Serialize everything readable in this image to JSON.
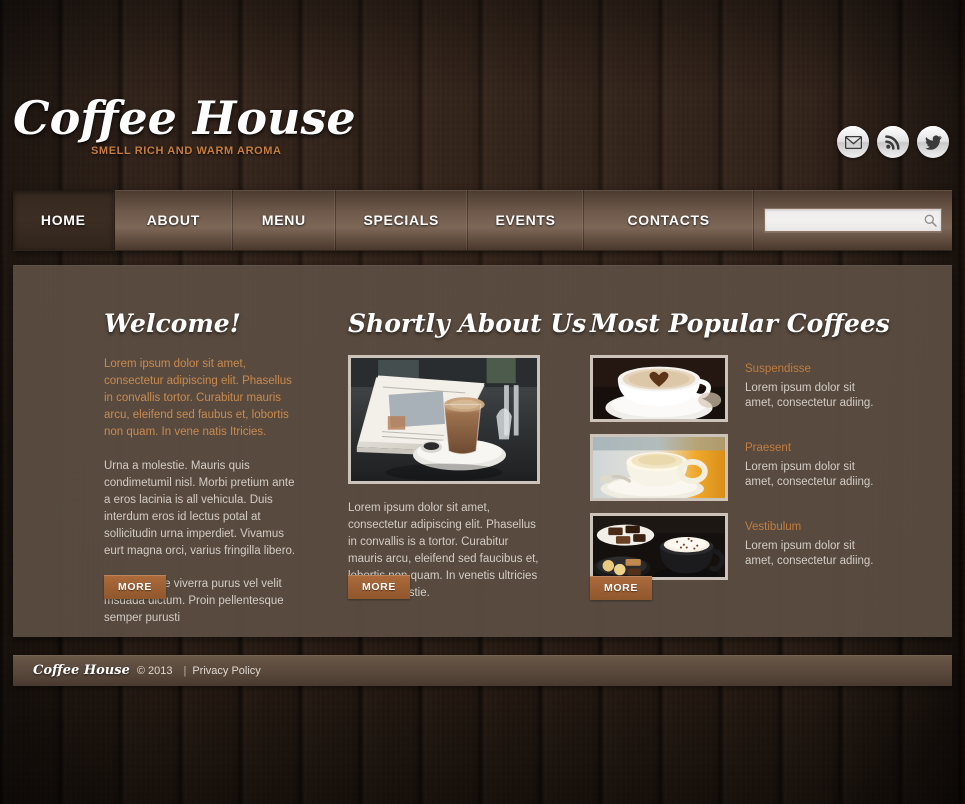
{
  "site": {
    "logo_title": "Coffee House",
    "logo_tagline": "SMELL RICH AND WARM AROMA"
  },
  "theme": {
    "accent_orange": "#c67d3e",
    "button_brown": "#9c5f33",
    "panel_brown": "#5c4e42",
    "wood_dark": "#2a1d16",
    "body_text": "#d3cdc6"
  },
  "social": [
    {
      "name": "mail-icon",
      "label": "Email"
    },
    {
      "name": "rss-icon",
      "label": "RSS"
    },
    {
      "name": "twitter-icon",
      "label": "Twitter"
    }
  ],
  "nav": {
    "items": [
      {
        "label": "HOME",
        "active": true
      },
      {
        "label": "ABOUT",
        "active": false
      },
      {
        "label": "MENU",
        "active": false
      },
      {
        "label": "SPECIALS",
        "active": false
      },
      {
        "label": "EVENTS",
        "active": false
      },
      {
        "label": "CONTACTS",
        "active": false
      }
    ]
  },
  "search": {
    "value": "",
    "placeholder": "",
    "icon": "search-icon"
  },
  "columns": {
    "welcome": {
      "heading": "Welcome!",
      "intro": "Lorem ipsum dolor sit amet, consectetur adipiscing elit. Phasellus in convallis tortor. Curabitur mauris arcu, eleifend sed faubus et, lobortis non quam. In vene natis  Itricies.",
      "paragraph_1": "Urna a molestie. Mauris quis condimetumil nisl. Morbi pretium ante a eros lacinia is all vehicula. Duis interdum eros id lectus potal at sollicitudin urna imperdiet. Vivamus eurt magna orci, varius fringilla libero.",
      "paragraph_2": "Pellentesque viverra purus vel velit msuada dictum. Proin pellentesque semper purusti",
      "more_label": "MORE"
    },
    "about": {
      "heading": "Shortly About Us",
      "photo_alt": "latte glass beside newspapers on a cafe table",
      "paragraph": "Lorem ipsum dolor sit amet, consectetur adipiscing elit. Phasellus in convallis is a tortor. Curabitur mauris arcu, eleifend sed faucibus et, lobortis non quam. In venetis ultricies urna a molestie.",
      "more_label": "MORE"
    },
    "coffees": {
      "heading": "Most Popular Coffees",
      "more_label": "MORE",
      "items": [
        {
          "title": "Suspendisse",
          "desc": "Lorem ipsum dolor sit amet, consectetur adiing.",
          "photo_alt": "cappuccino with cocoa heart on foam"
        },
        {
          "title": "Praesent",
          "desc": "Lorem ipsum dolor sit amet, consectetur adiing.",
          "photo_alt": "cappuccino cup on saucer with orange background"
        },
        {
          "title": "Vestibulum",
          "desc": "Lorem ipsum dolor sit amet, consectetur adiing.",
          "photo_alt": "hot chocolate with cream and petits fours"
        }
      ]
    }
  },
  "footer": {
    "logo": "Coffee House",
    "copyright": "© 2013",
    "separator": "|",
    "privacy_label": "Privacy Policy"
  }
}
